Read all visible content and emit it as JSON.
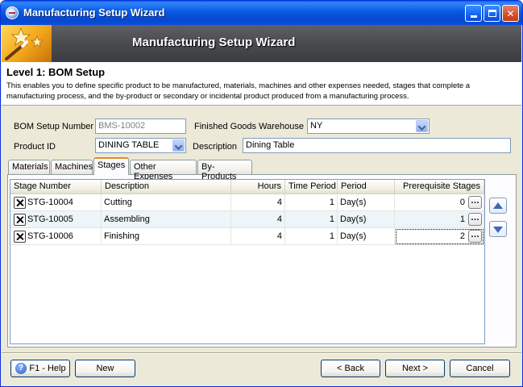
{
  "window": {
    "title": "Manufacturing Setup Wizard"
  },
  "banner": {
    "title": "Manufacturing Setup Wizard"
  },
  "header": {
    "level_title": "Level 1: BOM Setup",
    "description": "This enables you to define specific product to be manufactured, materials, machines and other expenses needed, stages that complete a manufacturing process, and the by-product or secondary or incidental product produced from a manufacturing process."
  },
  "form": {
    "bom_label": "BOM Setup Number",
    "bom_value": "BMS-10002",
    "warehouse_label": "Finished Goods Warehouse",
    "warehouse_value": "NY",
    "product_label": "Product ID",
    "product_value": "DINING TABLE",
    "description_label": "Description",
    "description_value": "Dining Table"
  },
  "tabs": [
    "Materials",
    "Machines",
    "Stages",
    "Other Expenses",
    "By-Products"
  ],
  "active_tab": "Stages",
  "grid": {
    "columns": [
      "Stage Number",
      "Description",
      "Hours",
      "Time Period",
      "Period",
      "Prerequisite Stages"
    ],
    "rows": [
      {
        "stage": "STG-10004",
        "description": "Cutting",
        "hours": "4",
        "time_period": "1",
        "period": "Day(s)",
        "prereq": "0"
      },
      {
        "stage": "STG-10005",
        "description": "Assembling",
        "hours": "4",
        "time_period": "1",
        "period": "Day(s)",
        "prereq": "1"
      },
      {
        "stage": "STG-10006",
        "description": "Finishing",
        "hours": "4",
        "time_period": "1",
        "period": "Day(s)",
        "prereq": "2"
      }
    ]
  },
  "footer": {
    "help_label": "F1 - Help",
    "new_label": "New",
    "back_label": "< Back",
    "next_label": "Next >",
    "cancel_label": "Cancel"
  },
  "icons": {
    "delete_row": "close-icon",
    "ellipsis": "ellipsis-icon",
    "move_up": "arrow-up-icon",
    "move_down": "arrow-down-icon",
    "help": "help-icon"
  },
  "colors": {
    "titlebar": "#0a58e0",
    "banner": "#4a4b4f",
    "active_tab_accent": "#e68b2c",
    "window_bg": "#ece9d8"
  }
}
